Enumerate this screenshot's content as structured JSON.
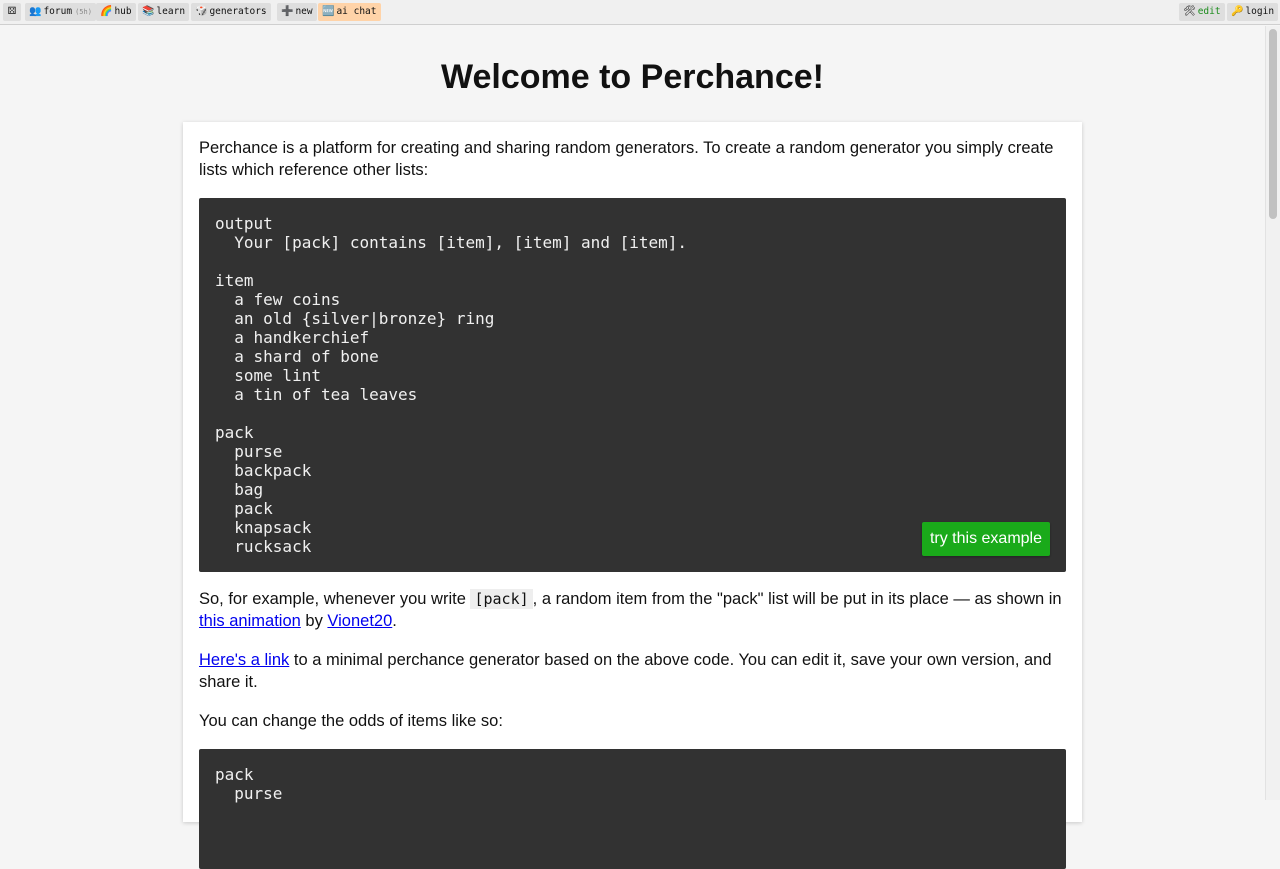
{
  "topbar": {
    "left": [
      {
        "icon": "⚄",
        "label": "",
        "sub": ""
      },
      {
        "icon": "👥",
        "label": "forum",
        "sub": "(5h)"
      },
      {
        "icon": "🌈",
        "label": "hub",
        "sub": ""
      },
      {
        "icon": "📚",
        "label": "learn",
        "sub": ""
      },
      {
        "icon": "🎲",
        "label": "generators",
        "sub": ""
      },
      {
        "icon": "➕",
        "label": "new",
        "sub": ""
      },
      {
        "icon": "🆕",
        "label": "ai chat",
        "sub": ""
      }
    ],
    "right": [
      {
        "icon": "🛠",
        "label": "edit"
      },
      {
        "icon": "🔑",
        "label": "login"
      }
    ]
  },
  "page": {
    "title": "Welcome to Perchance!",
    "intro": "Perchance is a platform for creating and sharing random generators. To create a random generator you simply create lists which reference other lists:",
    "code1": {
      "blocks": [
        [
          "output",
          "  Your [pack] contains [item], [item] and [item]."
        ],
        [
          "item",
          "  a few coins",
          "  an old {silver|bronze} ring",
          "  a handkerchief",
          "  a shard of bone",
          "  some lint",
          "  a tin of tea leaves"
        ],
        [
          "pack",
          "  purse",
          "  backpack",
          "  bag",
          "  pack",
          "  knapsack",
          "  rucksack"
        ]
      ],
      "button": "try this example"
    },
    "para2": {
      "before": "So, for example, whenever you write ",
      "code": "[pack]",
      "after": ", a random item from the \"pack\" list will be put in its place — as shown in ",
      "link1": "this animation",
      "mid": " by ",
      "link2": "Vionet20",
      "end": "."
    },
    "para3": {
      "link": "Here's a link",
      "text": " to a minimal perchance generator based on the above code. You can edit it, save your own version, and share it."
    },
    "para4": "You can change the odds of items like so:",
    "code2": {
      "lines": [
        "pack",
        "  purse"
      ]
    }
  }
}
